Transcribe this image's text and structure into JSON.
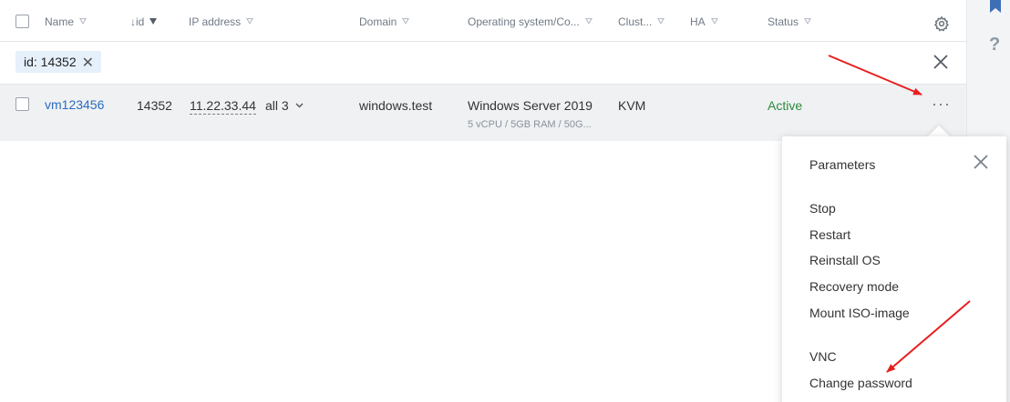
{
  "table": {
    "columns": [
      {
        "label": "Name"
      },
      {
        "label": "↓id"
      },
      {
        "label": "IP address"
      },
      {
        "label": "Domain"
      },
      {
        "label": "Operating system/Co..."
      },
      {
        "label": "Clust..."
      },
      {
        "label": "HA"
      },
      {
        "label": "Status"
      }
    ],
    "filter_chip": "id: 14352",
    "row": {
      "name": "vm123456",
      "id": "14352",
      "ip": "11.22.33.44",
      "ip_more": "all 3",
      "domain": "windows.test",
      "os": "Windows Server 2019",
      "os_details": "5 vCPU / 5GB RAM / 50G...",
      "cluster": "KVM",
      "status": "Active"
    }
  },
  "menu": {
    "title": "Parameters",
    "group1": [
      "Stop",
      "Restart",
      "Reinstall OS",
      "Recovery mode",
      "Mount ISO-image"
    ],
    "group2": [
      "VNC",
      "Change password"
    ]
  },
  "colors": {
    "link": "#2d6cc0",
    "status_active": "#2d8a3c",
    "annotation_arrow": "#e81e1e",
    "chip_bg": "#e6f0fb"
  },
  "icons": {
    "settings": "gear-icon",
    "close": "close-icon",
    "more": "more-dots-icon",
    "filter": "filter-funnel-icon",
    "help": "help-icon"
  }
}
